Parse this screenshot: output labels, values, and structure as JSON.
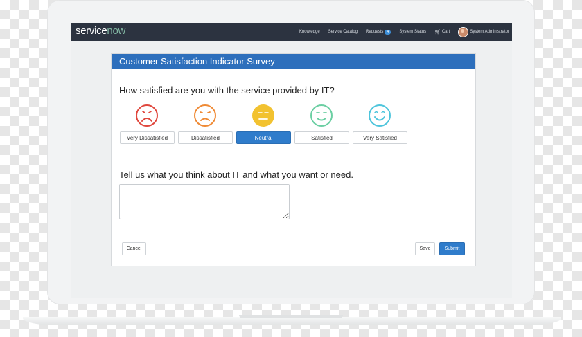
{
  "navbar": {
    "logo_main": "service",
    "logo_accent": "now",
    "links": [
      "Knowledge",
      "Service Catalog",
      "Requests",
      "System Status",
      "Cart"
    ],
    "requests_count": "4",
    "user": "System Administrator"
  },
  "survey": {
    "title": "Customer Satisfaction Indicator Survey",
    "question1": "How satisfied are you with the service provided by IT?",
    "ratings": [
      {
        "label": "Very Dissatisfied",
        "face": "very-dissatisfied-face-icon",
        "color": "#e0473d"
      },
      {
        "label": "Dissatisfied",
        "face": "dissatisfied-face-icon",
        "color": "#ef8a35"
      },
      {
        "label": "Neutral",
        "face": "neutral-face-icon",
        "color": "#f2c230"
      },
      {
        "label": "Satisfied",
        "face": "satisfied-face-icon",
        "color": "#6ccfa3"
      },
      {
        "label": "Very Satisfied",
        "face": "very-satisfied-face-icon",
        "color": "#4ec5dc"
      }
    ],
    "selected": "Neutral",
    "question2": "Tell us what you think about IT and what you want or need.",
    "feedback_value": "",
    "cancel": "Cancel",
    "save": "Save",
    "submit": "Submit"
  },
  "colors": {
    "header": "#2d6fbc",
    "navbar": "#2c3340",
    "primary": "#2f7ccb"
  }
}
